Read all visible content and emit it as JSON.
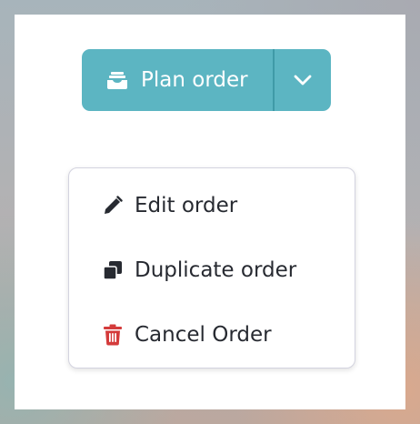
{
  "actions": {
    "main_label": "Plan order",
    "main_icon": "inbox-tray-icon",
    "toggle_icon": "chevron-down-icon",
    "button_color": "#5cb5c2"
  },
  "menu": {
    "items": [
      {
        "label": "Edit order",
        "icon": "pencil-icon"
      },
      {
        "label": "Duplicate order",
        "icon": "copy-icon"
      },
      {
        "label": "Cancel Order",
        "icon": "trash-icon",
        "color": "#d43b3b"
      }
    ]
  }
}
